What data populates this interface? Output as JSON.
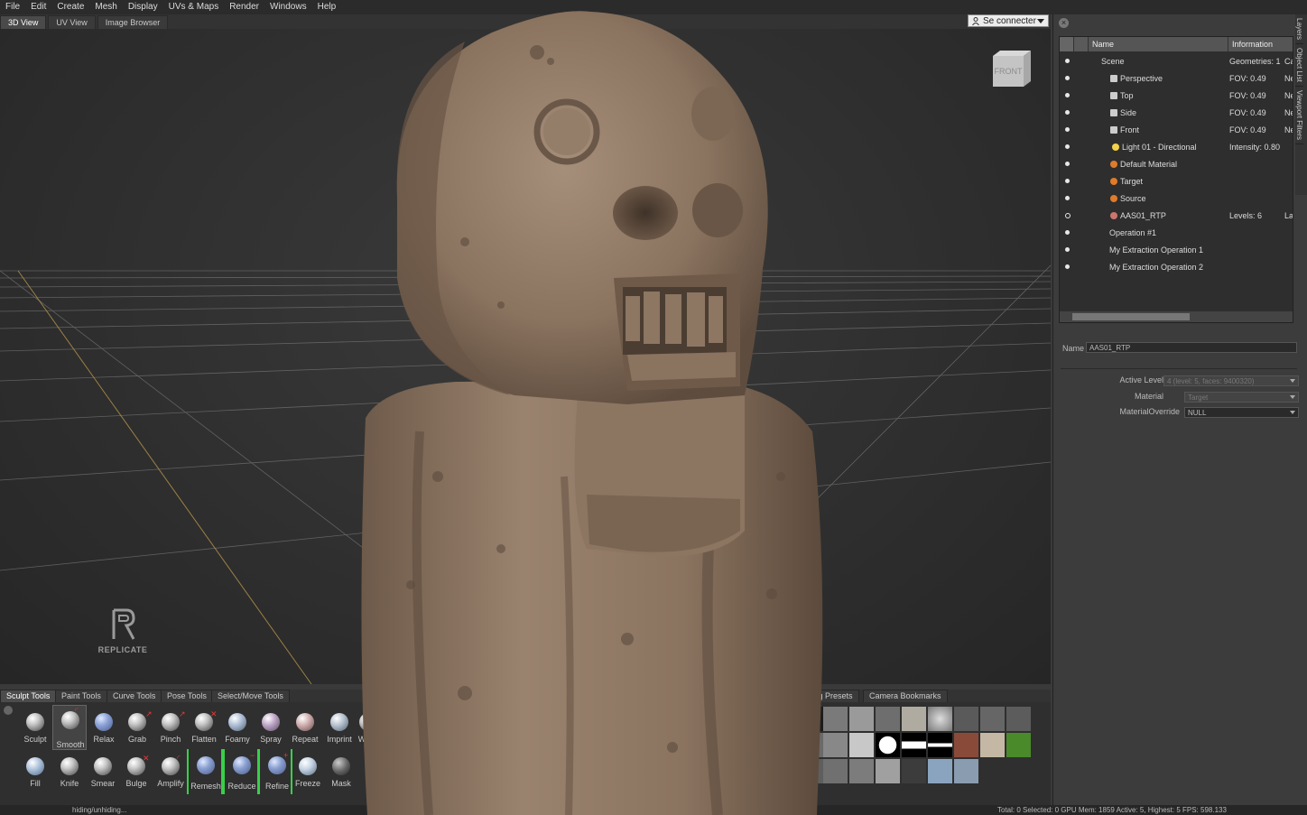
{
  "menu": [
    "File",
    "Edit",
    "Create",
    "Mesh",
    "Display",
    "UVs & Maps",
    "Render",
    "Windows",
    "Help"
  ],
  "view_tabs": [
    "3D View",
    "UV View",
    "Image Browser"
  ],
  "connect_button": "Se connecter",
  "viewcube_label": "FRONT",
  "brand_logo": "REPLICATE",
  "side_tabs": [
    "Layers",
    "Object List",
    "Viewport Filters"
  ],
  "scene_tree": {
    "col_name": "Name",
    "col_info": "Information",
    "rows": [
      {
        "name": "Scene",
        "info": "Geometries: 1",
        "info2": "Ca",
        "visible": true
      },
      {
        "name": "Perspective",
        "info": "FOV: 0.49",
        "info2": "Ne",
        "visible": true
      },
      {
        "name": "Top",
        "info": "FOV: 0.49",
        "info2": "Ne",
        "visible": true
      },
      {
        "name": "Side",
        "info": "FOV: 0.49",
        "info2": "Ne",
        "visible": true
      },
      {
        "name": "Front",
        "info": "FOV: 0.49",
        "info2": "Ne",
        "visible": true
      },
      {
        "name": "Light 01 - Directional",
        "info": "Intensity: 0.80",
        "info2": "",
        "visible": true
      },
      {
        "name": "Default Material",
        "info": "",
        "info2": "",
        "visible": true
      },
      {
        "name": "Target",
        "info": "",
        "info2": "",
        "visible": true
      },
      {
        "name": "Source",
        "info": "",
        "info2": "",
        "visible": true
      },
      {
        "name": "AAS01_RTP",
        "info": "Levels: 6",
        "info2": "La",
        "visible": false
      },
      {
        "name": "Operation #1",
        "info": "",
        "info2": "",
        "visible": true
      },
      {
        "name": "My Extraction Operation 1",
        "info": "",
        "info2": "",
        "visible": true
      },
      {
        "name": "My Extraction Operation 2",
        "info": "",
        "info2": "",
        "visible": true
      }
    ]
  },
  "properties": {
    "name_label": "Name",
    "name_value": "AAS01_RTP",
    "active_level_label": "Active Level",
    "active_level_value": "4 (level: 5, faces: 9400320)",
    "material_label": "Material",
    "material_value": "Target",
    "material_override_label": "MaterialOverride",
    "material_override_value": "NULL"
  },
  "bottom_tabs": [
    "Sculpt Tools",
    "Paint Tools",
    "Curve Tools",
    "Pose Tools",
    "Select/Move Tools",
    "ighting Presets",
    "Camera Bookmarks"
  ],
  "tools_row1": [
    "Sculpt",
    "Smooth",
    "Relax",
    "Grab",
    "Pinch",
    "Flatten",
    "Foamy",
    "Spray",
    "Repeat",
    "Imprint",
    "W"
  ],
  "tools_row2": [
    "Fill",
    "Knife",
    "Smear",
    "Bulge",
    "Amplify",
    "Remesh",
    "Reduce",
    "Refine",
    "Freeze",
    "Mask"
  ],
  "status": {
    "left": "hiding/unhiding...",
    "right": "Total: 0  Selected: 0 GPU Mem: 1859  Active: 5, Highest: 5  FPS: 598.133"
  },
  "colors": {
    "statue": "#8a735f",
    "selection_bracket": "#38d04a",
    "grid_line": "#8a8a8a",
    "axis_line": "#b8964a"
  }
}
